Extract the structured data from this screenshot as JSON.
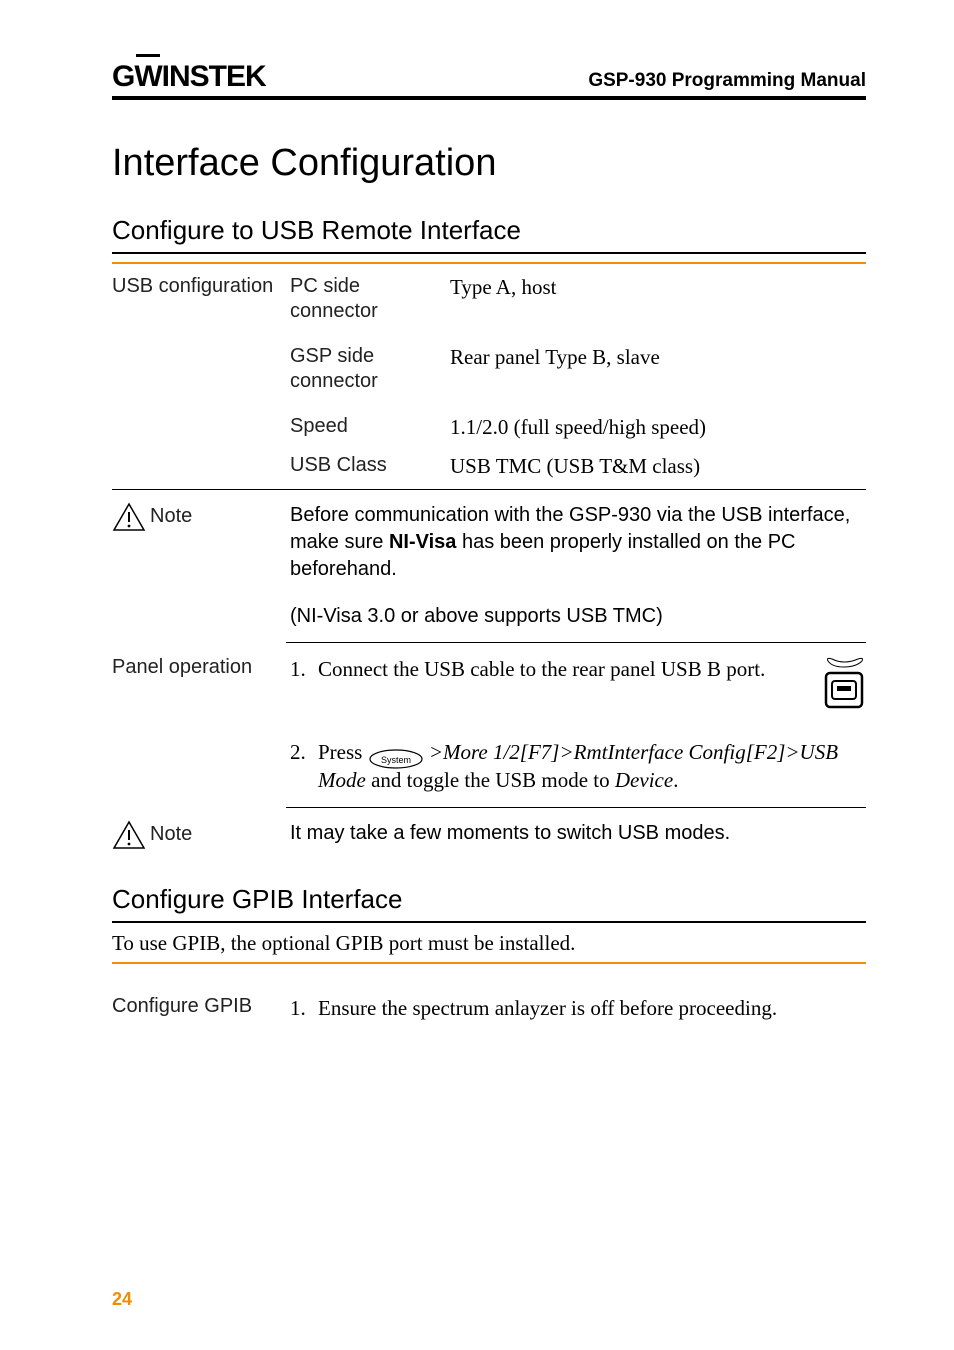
{
  "header": {
    "brand": "GWINSTEK",
    "title": "GSP-930 Programming Manual"
  },
  "main_heading": "Interface Configuration",
  "section1": {
    "heading": "Configure to USB Remote Interface",
    "label": "USB configuration",
    "rows": [
      {
        "mid": "PC side connector",
        "val": "Type A, host"
      },
      {
        "mid": "GSP side connector",
        "val": "Rear panel Type B, slave"
      },
      {
        "mid": "Speed",
        "val": "1.1/2.0 (full speed/high speed)"
      },
      {
        "mid": "USB Class",
        "val": "USB TMC (USB T&M class)"
      }
    ],
    "note": {
      "label": "Note",
      "p1a": "Before communication with the GSP-930 via the USB interface, make sure ",
      "p1b": "NI-Visa",
      "p1c": " has been properly installed on the PC beforehand.",
      "p2": "(NI-Visa 3.0 or above supports USB TMC)"
    },
    "panel": {
      "label": "Panel operation",
      "step1_num": "1.",
      "step1_text": "Connect the USB cable to the rear panel USB B port.",
      "step2_num": "2.",
      "step2_prefix": "Press ",
      "step2_cmd1": ">More 1/2[F7]>RmtInterface Config[F2]>USB Mode",
      "step2_mid": " and toggle the USB mode to ",
      "step2_cmd2": "Device",
      "step2_suffix": "."
    },
    "note2": {
      "label": "Note",
      "text": "It may take a few moments to switch USB modes."
    }
  },
  "section2": {
    "heading": "Configure GPIB Interface",
    "intro": "To use GPIB, the optional GPIB port must be installed.",
    "label": "Configure GPIB",
    "step1_num": "1.",
    "step1_text": "Ensure the spectrum anlayzer is off before proceeding."
  },
  "page_number": "24"
}
